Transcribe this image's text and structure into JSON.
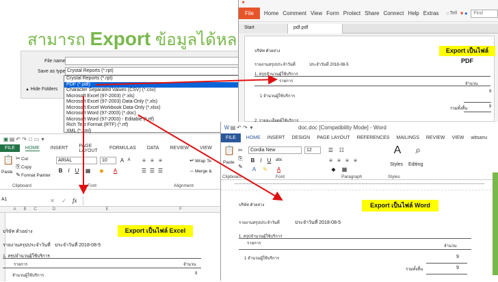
{
  "banner": {
    "pre": "สามารถ ",
    "export": "Export",
    "post": " ข้อมูลได้หลากหลาย"
  },
  "dialog": {
    "file_name_label": "File name:",
    "save_as_label": "Save as type:",
    "save_as_value": "Crystal Reports (*.rpt)",
    "hide_folders": "Hide Folders",
    "types": [
      "Crystal Reports (*.rpt)",
      "PDF (*.pdf)",
      "Character Separated Values (CSV) (*.csv)",
      "Microsoft Excel (97-2003) (*.xls)",
      "Microsoft Excel (97-2003) Data-Only (*.xls)",
      "Microsoft Excel Workbook Data-Only (*.xlsx)",
      "Microsoft Word (97-2003) (*.doc)",
      "Microsoft Word (97-2003) - Editable (*.rtf)",
      "Rich Text Format (RTF) (*.rtf)",
      "XML (*.xml)"
    ]
  },
  "pdf": {
    "file_tab": "File",
    "menu": [
      "Home",
      "Comment",
      "View",
      "Form",
      "Protect",
      "Share",
      "Connect",
      "Help",
      "Extras"
    ],
    "user": "Tell",
    "search_placeholder": "Find",
    "tabs": [
      "Start",
      "pdf.pdf"
    ],
    "badge": "Export เป็นไฟล์ PDF",
    "company": "บริษัท ตัวอย่าง",
    "report_title": "รายงานสรุปประจำวันที่",
    "report_date": "ประจำวันที่ 2018-08-5",
    "section": "1. สรุปจำนวนผู้ใช้บริการ",
    "col_item": "รายการ",
    "col_amount": "จำนวน",
    "row1": "1 จำนวนผู้ใช้บริการ",
    "row1_val": "9",
    "total_label": "รวมทั้งสิ้น",
    "total_val": "9",
    "section2": "2. รายละเอียดผู้ใช้บริการ"
  },
  "excel": {
    "file_tab": "FILE",
    "tabs": [
      "HOME",
      "INSERT",
      "PAGE LAYOUT",
      "FORMULAS",
      "DATA",
      "REVIEW",
      "VIEW"
    ],
    "cut": "Cut",
    "copy": "Copy",
    "paste": "Paste",
    "format_painter": "Format Painter",
    "clipboard": "Clipboard",
    "font_name": "ARIAL",
    "font_size": "10",
    "font_group": "Font",
    "alignment": "Alignment",
    "wrap": "Wrap Te",
    "merge": "Merge &",
    "name_box": "A1",
    "fx": "fx",
    "columns": [
      "A",
      "B",
      "C",
      "D",
      "E",
      "F"
    ],
    "badge": "Export เป็นไฟล์  Excel",
    "company": "บริษัท ตัวอย่าง",
    "report_title": "รายงานสรุปประจำวันที่",
    "report_date": "ประจำวันที่ 2018-08-5",
    "section": "1. สรุปจำนวนผู้ใช้บริการ",
    "col_item": "รายการ",
    "col_amount": "จำนวน",
    "row1": "จำนวนผู้ใช้บริการ",
    "row1_val": "9",
    "rows": [
      "1",
      "2",
      "3",
      "4",
      "5",
      "6",
      "7",
      "8",
      "9",
      "10",
      "11",
      "12",
      "13"
    ]
  },
  "word": {
    "title": "doc.doc [Compatibility Mode] - Word",
    "file_tab": "FILE",
    "tabs": [
      "HOME",
      "INSERT",
      "DESIGN",
      "PAGE LAYOUT",
      "REFERENCES",
      "MAILINGS",
      "REVIEW",
      "VIEW"
    ],
    "user": "witsanu",
    "font_name": "Cordia New",
    "font_size": "12",
    "paste": "Paste",
    "clipboard": "Clipboard",
    "font_group": "Font",
    "paragraph": "Paragraph",
    "styles": "Styles",
    "styles_group": "Styles",
    "editing": "Editing",
    "badge": "Export เป็นไฟล์ Word",
    "company": "บริษัท ตัวอย่าง",
    "report_title": "รายงานสรุปประจำวันที่",
    "report_date": "ประจำวันที่ 2018-08-5",
    "section": "1. สรุปจำนวนผู้ใช้บริการ",
    "col_item": "รายการ",
    "col_amount": "จำนวน",
    "row1": "1 จำนวนผู้ใช้บริการ",
    "row1_val": "9",
    "total_label": "รวมทั้งสิ้น",
    "total_val": "9"
  },
  "colors": {
    "excel_green": "#217346",
    "word_blue": "#2b579a",
    "pdf_orange": "#e8542a",
    "arrow_red": "#e01010",
    "badge_yellow": "#ffff00",
    "banner_green": "#79b84a"
  }
}
